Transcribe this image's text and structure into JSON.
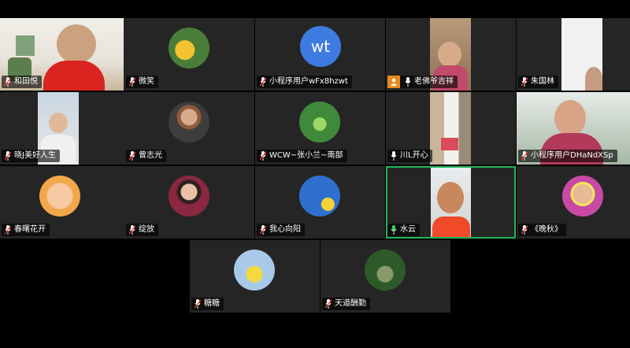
{
  "participants": [
    {
      "name": "和田悦"
    },
    {
      "name": "微笑"
    },
    {
      "name": "小程序用户wFx8hzwt",
      "initials": "wt"
    },
    {
      "name": "老佛爷吉祥"
    },
    {
      "name": "朱国林"
    },
    {
      "name": "晓J美好人生"
    },
    {
      "name": "曾志光"
    },
    {
      "name": "WCW~张小兰~南部"
    },
    {
      "name": "川L开心"
    },
    {
      "name": "小程序用户DHaNdXSp"
    },
    {
      "name": "春曙花开"
    },
    {
      "name": "绽放"
    },
    {
      "name": "我心向阳"
    },
    {
      "name": "水云"
    },
    {
      "name": "《晚秋》"
    },
    {
      "name": "糖糖"
    },
    {
      "name": "天道酬勤"
    }
  ],
  "colors": {
    "active_speaker_border": "#23b55c",
    "mic_on": "#33cc55",
    "mic_muted": "#ff3b30",
    "host_badge": "#e98a1e"
  }
}
